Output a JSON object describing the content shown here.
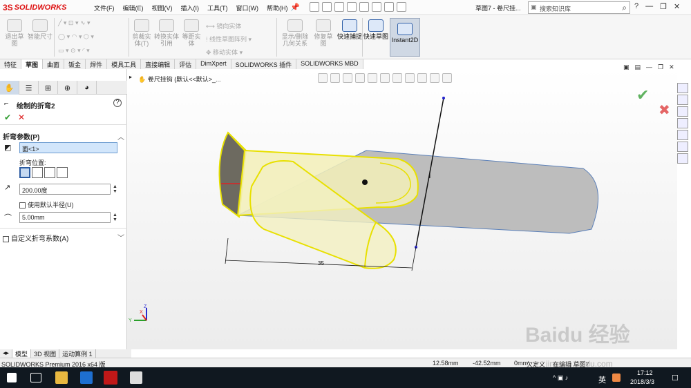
{
  "app": {
    "logo_prefix": "3S",
    "logo_text": "SOLIDWORKS",
    "document_title": "草图7 - 卷尺挂...",
    "search_placeholder": "搜索知识库",
    "search_icon": "search-icon",
    "help_text": "?",
    "pin_icon": "pin-icon"
  },
  "menu": [
    "文件(F)",
    "编辑(E)",
    "视图(V)",
    "插入(I)",
    "工具(T)",
    "窗口(W)",
    "帮助(H)"
  ],
  "ribbon": {
    "exit_sketch": "退出草图",
    "smart_dim": "智能尺寸",
    "trim": "剪裁实体(T)",
    "convert": "转换实体引用",
    "offset": "等距实体",
    "mirror": "镜向实体",
    "linear_pattern": "线性草图阵列",
    "move": "移动实体",
    "display_relations": "显示/删除几何关系",
    "repair": "修复草图",
    "quick_snap": "快速捕捉",
    "rapid_sketch": "快速草图",
    "instant2d": "Instant2D"
  },
  "command_tabs": [
    {
      "label": "特征",
      "active": false
    },
    {
      "label": "草图",
      "active": true
    },
    {
      "label": "曲面",
      "active": false
    },
    {
      "label": "钣金",
      "active": false
    },
    {
      "label": "焊件",
      "active": false
    },
    {
      "label": "模具工具",
      "active": false
    },
    {
      "label": "直接编辑",
      "active": false
    },
    {
      "label": "评估",
      "active": false
    },
    {
      "label": "DimXpert",
      "active": false
    },
    {
      "label": "SOLIDWORKS 插件",
      "active": false
    },
    {
      "label": "SOLIDWORKS MBD",
      "active": false
    }
  ],
  "property_manager": {
    "title": "绘制的折弯2",
    "ok_icon": "check-icon",
    "cancel_icon": "close-icon",
    "group_title": "折弯参数(P)",
    "fixed_face_value": "面<1>",
    "bend_position_label": "折弯位置:",
    "angle_value": "200.00度",
    "use_default_radius_label": "使用默认半径(U)",
    "radius_value": "5.00mm",
    "custom_bend_label": "自定义折弯系数(A)"
  },
  "viewport": {
    "tree_title": "卷尺挂钩 (默认<<默认>_...",
    "dimension_value": "35",
    "axis_x": "X",
    "axis_y": "Y",
    "axis_z": "Z"
  },
  "bottom_tabs": [
    {
      "label": "模型",
      "active": true
    },
    {
      "label": "3D 视图",
      "active": false
    },
    {
      "label": "运动算例 1",
      "active": false
    }
  ],
  "status_bar": {
    "product": "SOLIDWORKS Premium 2016 x64 版",
    "x": "12.58mm",
    "y": "-42.52mm",
    "z": "0mm",
    "state": "欠定义",
    "editing": "在编辑 草图7"
  },
  "taskbar": {
    "ime": "英",
    "time": "17:12",
    "date": "2018/3/3"
  },
  "watermark": {
    "brand": "Baidu 经验",
    "url": "jingyan.baidu.com"
  },
  "colors": {
    "brand": "#d11111",
    "selection": "#f2ec2a",
    "ok": "#2c9a2c",
    "cancel": "#d33333"
  }
}
